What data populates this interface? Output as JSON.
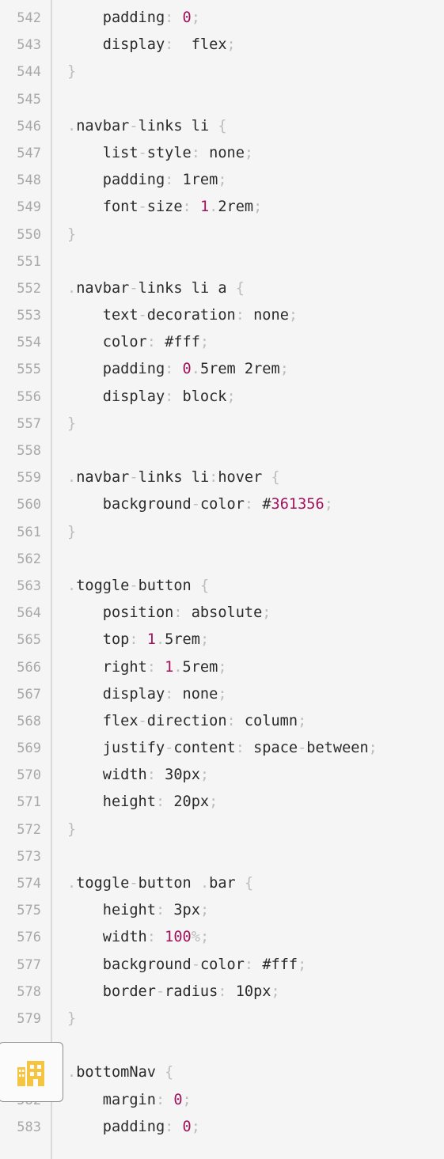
{
  "colors": {
    "background": "#f5f5f5",
    "line_number": "#a8a8a8",
    "text": "#2a2a2a",
    "punctuation": "#bdbdbd",
    "number": "#a0135c",
    "accent_icon": "#f5c542"
  },
  "icons": {
    "floating_widget": "building-icon"
  },
  "lines": [
    {
      "n": "542",
      "tokens": [
        {
          "t": "    padding",
          "k": "text"
        },
        {
          "t": ": ",
          "k": "punc"
        },
        {
          "t": "0",
          "k": "num"
        },
        {
          "t": ";",
          "k": "punc"
        }
      ]
    },
    {
      "n": "543",
      "tokens": [
        {
          "t": "    display",
          "k": "text"
        },
        {
          "t": ":  ",
          "k": "punc"
        },
        {
          "t": "flex",
          "k": "text"
        },
        {
          "t": ";",
          "k": "punc"
        }
      ]
    },
    {
      "n": "544",
      "tokens": [
        {
          "t": "}",
          "k": "punc"
        }
      ]
    },
    {
      "n": "545",
      "tokens": []
    },
    {
      "n": "546",
      "tokens": [
        {
          "t": ".",
          "k": "punc"
        },
        {
          "t": "navbar",
          "k": "text"
        },
        {
          "t": "-",
          "k": "punc"
        },
        {
          "t": "links li ",
          "k": "text"
        },
        {
          "t": "{",
          "k": "punc"
        }
      ]
    },
    {
      "n": "547",
      "tokens": [
        {
          "t": "    list",
          "k": "text"
        },
        {
          "t": "-",
          "k": "punc"
        },
        {
          "t": "style",
          "k": "text"
        },
        {
          "t": ": ",
          "k": "punc"
        },
        {
          "t": "none",
          "k": "text"
        },
        {
          "t": ";",
          "k": "punc"
        }
      ]
    },
    {
      "n": "548",
      "tokens": [
        {
          "t": "    padding",
          "k": "text"
        },
        {
          "t": ": ",
          "k": "punc"
        },
        {
          "t": "1rem",
          "k": "text"
        },
        {
          "t": ";",
          "k": "punc"
        }
      ]
    },
    {
      "n": "549",
      "tokens": [
        {
          "t": "    font",
          "k": "text"
        },
        {
          "t": "-",
          "k": "punc"
        },
        {
          "t": "size",
          "k": "text"
        },
        {
          "t": ": ",
          "k": "punc"
        },
        {
          "t": "1",
          "k": "num"
        },
        {
          "t": ".",
          "k": "punc"
        },
        {
          "t": "2rem",
          "k": "text"
        },
        {
          "t": ";",
          "k": "punc"
        }
      ]
    },
    {
      "n": "550",
      "tokens": [
        {
          "t": "}",
          "k": "punc"
        }
      ]
    },
    {
      "n": "551",
      "tokens": []
    },
    {
      "n": "552",
      "tokens": [
        {
          "t": ".",
          "k": "punc"
        },
        {
          "t": "navbar",
          "k": "text"
        },
        {
          "t": "-",
          "k": "punc"
        },
        {
          "t": "links li a ",
          "k": "text"
        },
        {
          "t": "{",
          "k": "punc"
        }
      ]
    },
    {
      "n": "553",
      "tokens": [
        {
          "t": "    text",
          "k": "text"
        },
        {
          "t": "-",
          "k": "punc"
        },
        {
          "t": "decoration",
          "k": "text"
        },
        {
          "t": ": ",
          "k": "punc"
        },
        {
          "t": "none",
          "k": "text"
        },
        {
          "t": ";",
          "k": "punc"
        }
      ]
    },
    {
      "n": "554",
      "tokens": [
        {
          "t": "    color",
          "k": "text"
        },
        {
          "t": ": ",
          "k": "punc"
        },
        {
          "t": "#fff",
          "k": "text"
        },
        {
          "t": ";",
          "k": "punc"
        }
      ]
    },
    {
      "n": "555",
      "tokens": [
        {
          "t": "    padding",
          "k": "text"
        },
        {
          "t": ": ",
          "k": "punc"
        },
        {
          "t": "0",
          "k": "num"
        },
        {
          "t": ".",
          "k": "punc"
        },
        {
          "t": "5rem 2rem",
          "k": "text"
        },
        {
          "t": ";",
          "k": "punc"
        }
      ]
    },
    {
      "n": "556",
      "tokens": [
        {
          "t": "    display",
          "k": "text"
        },
        {
          "t": ": ",
          "k": "punc"
        },
        {
          "t": "block",
          "k": "text"
        },
        {
          "t": ";",
          "k": "punc"
        }
      ]
    },
    {
      "n": "557",
      "tokens": [
        {
          "t": "}",
          "k": "punc"
        }
      ]
    },
    {
      "n": "558",
      "tokens": []
    },
    {
      "n": "559",
      "tokens": [
        {
          "t": ".",
          "k": "punc"
        },
        {
          "t": "navbar",
          "k": "text"
        },
        {
          "t": "-",
          "k": "punc"
        },
        {
          "t": "links li",
          "k": "text"
        },
        {
          "t": ":",
          "k": "punc"
        },
        {
          "t": "hover ",
          "k": "text"
        },
        {
          "t": "{",
          "k": "punc"
        }
      ]
    },
    {
      "n": "560",
      "tokens": [
        {
          "t": "    background",
          "k": "text"
        },
        {
          "t": "-",
          "k": "punc"
        },
        {
          "t": "color",
          "k": "text"
        },
        {
          "t": ": ",
          "k": "punc"
        },
        {
          "t": "#",
          "k": "text"
        },
        {
          "t": "361356",
          "k": "num"
        },
        {
          "t": ";",
          "k": "punc"
        }
      ]
    },
    {
      "n": "561",
      "tokens": [
        {
          "t": "}",
          "k": "punc"
        }
      ]
    },
    {
      "n": "562",
      "tokens": []
    },
    {
      "n": "563",
      "tokens": [
        {
          "t": ".",
          "k": "punc"
        },
        {
          "t": "toggle",
          "k": "text"
        },
        {
          "t": "-",
          "k": "punc"
        },
        {
          "t": "button ",
          "k": "text"
        },
        {
          "t": "{",
          "k": "punc"
        }
      ]
    },
    {
      "n": "564",
      "tokens": [
        {
          "t": "    position",
          "k": "text"
        },
        {
          "t": ": ",
          "k": "punc"
        },
        {
          "t": "absolute",
          "k": "text"
        },
        {
          "t": ";",
          "k": "punc"
        }
      ]
    },
    {
      "n": "565",
      "tokens": [
        {
          "t": "    top",
          "k": "text"
        },
        {
          "t": ": ",
          "k": "punc"
        },
        {
          "t": "1",
          "k": "num"
        },
        {
          "t": ".",
          "k": "punc"
        },
        {
          "t": "5rem",
          "k": "text"
        },
        {
          "t": ";",
          "k": "punc"
        }
      ]
    },
    {
      "n": "566",
      "tokens": [
        {
          "t": "    right",
          "k": "text"
        },
        {
          "t": ": ",
          "k": "punc"
        },
        {
          "t": "1",
          "k": "num"
        },
        {
          "t": ".",
          "k": "punc"
        },
        {
          "t": "5rem",
          "k": "text"
        },
        {
          "t": ";",
          "k": "punc"
        }
      ]
    },
    {
      "n": "567",
      "tokens": [
        {
          "t": "    display",
          "k": "text"
        },
        {
          "t": ": ",
          "k": "punc"
        },
        {
          "t": "none",
          "k": "text"
        },
        {
          "t": ";",
          "k": "punc"
        }
      ]
    },
    {
      "n": "568",
      "tokens": [
        {
          "t": "    flex",
          "k": "text"
        },
        {
          "t": "-",
          "k": "punc"
        },
        {
          "t": "direction",
          "k": "text"
        },
        {
          "t": ": ",
          "k": "punc"
        },
        {
          "t": "column",
          "k": "text"
        },
        {
          "t": ";",
          "k": "punc"
        }
      ]
    },
    {
      "n": "569",
      "tokens": [
        {
          "t": "    justify",
          "k": "text"
        },
        {
          "t": "-",
          "k": "punc"
        },
        {
          "t": "content",
          "k": "text"
        },
        {
          "t": ": ",
          "k": "punc"
        },
        {
          "t": "space",
          "k": "text"
        },
        {
          "t": "-",
          "k": "punc"
        },
        {
          "t": "between",
          "k": "text"
        },
        {
          "t": ";",
          "k": "punc"
        }
      ]
    },
    {
      "n": "570",
      "tokens": [
        {
          "t": "    width",
          "k": "text"
        },
        {
          "t": ": ",
          "k": "punc"
        },
        {
          "t": "30px",
          "k": "text"
        },
        {
          "t": ";",
          "k": "punc"
        }
      ]
    },
    {
      "n": "571",
      "tokens": [
        {
          "t": "    height",
          "k": "text"
        },
        {
          "t": ": ",
          "k": "punc"
        },
        {
          "t": "20px",
          "k": "text"
        },
        {
          "t": ";",
          "k": "punc"
        }
      ]
    },
    {
      "n": "572",
      "tokens": [
        {
          "t": "}",
          "k": "punc"
        }
      ]
    },
    {
      "n": "573",
      "tokens": []
    },
    {
      "n": "574",
      "tokens": [
        {
          "t": ".",
          "k": "punc"
        },
        {
          "t": "toggle",
          "k": "text"
        },
        {
          "t": "-",
          "k": "punc"
        },
        {
          "t": "button ",
          "k": "text"
        },
        {
          "t": ".",
          "k": "punc"
        },
        {
          "t": "bar ",
          "k": "text"
        },
        {
          "t": "{",
          "k": "punc"
        }
      ]
    },
    {
      "n": "575",
      "tokens": [
        {
          "t": "    height",
          "k": "text"
        },
        {
          "t": ": ",
          "k": "punc"
        },
        {
          "t": "3px",
          "k": "text"
        },
        {
          "t": ";",
          "k": "punc"
        }
      ]
    },
    {
      "n": "576",
      "tokens": [
        {
          "t": "    width",
          "k": "text"
        },
        {
          "t": ": ",
          "k": "punc"
        },
        {
          "t": "100",
          "k": "num"
        },
        {
          "t": "%",
          "k": "punc"
        },
        {
          "t": ";",
          "k": "punc"
        }
      ]
    },
    {
      "n": "577",
      "tokens": [
        {
          "t": "    background",
          "k": "text"
        },
        {
          "t": "-",
          "k": "punc"
        },
        {
          "t": "color",
          "k": "text"
        },
        {
          "t": ": ",
          "k": "punc"
        },
        {
          "t": "#fff",
          "k": "text"
        },
        {
          "t": ";",
          "k": "punc"
        }
      ]
    },
    {
      "n": "578",
      "tokens": [
        {
          "t": "    border",
          "k": "text"
        },
        {
          "t": "-",
          "k": "punc"
        },
        {
          "t": "radius",
          "k": "text"
        },
        {
          "t": ": ",
          "k": "punc"
        },
        {
          "t": "10px",
          "k": "text"
        },
        {
          "t": ";",
          "k": "punc"
        }
      ]
    },
    {
      "n": "579",
      "tokens": [
        {
          "t": "}",
          "k": "punc"
        }
      ]
    },
    {
      "n": "",
      "tokens": []
    },
    {
      "n": "",
      "tokens": [
        {
          "t": ".",
          "k": "punc"
        },
        {
          "t": "bottomNav ",
          "k": "text"
        },
        {
          "t": "{",
          "k": "punc"
        }
      ]
    },
    {
      "n": "582",
      "tokens": [
        {
          "t": "    margin",
          "k": "text"
        },
        {
          "t": ": ",
          "k": "punc"
        },
        {
          "t": "0",
          "k": "num"
        },
        {
          "t": ";",
          "k": "punc"
        }
      ]
    },
    {
      "n": "583",
      "tokens": [
        {
          "t": "    padding",
          "k": "text"
        },
        {
          "t": ": ",
          "k": "punc"
        },
        {
          "t": "0",
          "k": "num"
        },
        {
          "t": ";",
          "k": "punc"
        }
      ]
    }
  ]
}
